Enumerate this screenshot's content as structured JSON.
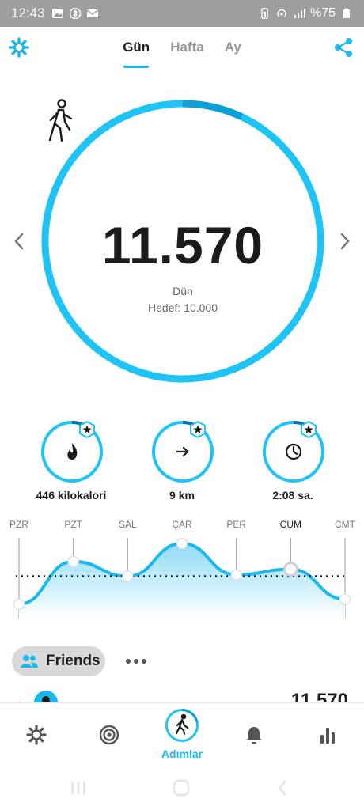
{
  "status_bar": {
    "time": "12:43",
    "battery": "%75"
  },
  "tabs": [
    {
      "label": "Gün",
      "active": true
    },
    {
      "label": "Hafta",
      "active": false
    },
    {
      "label": "Ay",
      "active": false
    }
  ],
  "main": {
    "steps": "11.570",
    "day": "Dün",
    "goal": "Hedef: 10.000",
    "progress": 1.0
  },
  "stats": [
    {
      "label": "446 kilokalori",
      "icon": "flame-icon",
      "progress": 0.1
    },
    {
      "label": "9 km",
      "icon": "arrow-right-icon",
      "progress": 0.1
    },
    {
      "label": "2:08 sa.",
      "icon": "clock-icon",
      "progress": 0.1
    }
  ],
  "chart_data": {
    "type": "area",
    "categories": [
      "PZR",
      "PZT",
      "SAL",
      "ÇAR",
      "PER",
      "CUM",
      "CMT"
    ],
    "selected": "CUM",
    "values": [
      0.05,
      0.66,
      0.45,
      0.92,
      0.47,
      0.55,
      0.12
    ],
    "goal_line": 0.45
  },
  "friends": {
    "label": "Friends",
    "peek_value": "11.570"
  },
  "bottom_nav": {
    "active_label": "Adımlar"
  },
  "colors": {
    "accent": "#1ab8ee",
    "ring_dark": "#0f9fd8"
  }
}
